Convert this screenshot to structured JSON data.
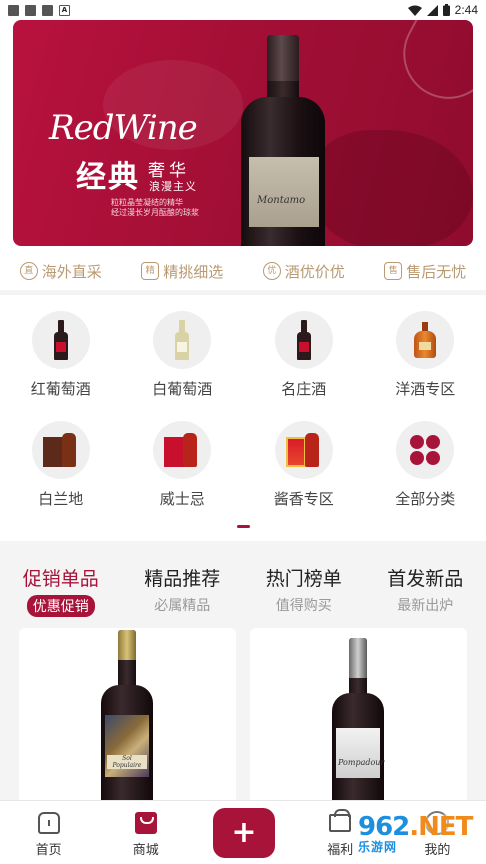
{
  "status_bar": {
    "time": "2:44",
    "icons": [
      "wifi-icon",
      "signal-icon",
      "battery-icon"
    ]
  },
  "banner": {
    "script_text": "RedWine",
    "title_main": "经典",
    "title_sub1": "奢华",
    "title_sub2": "浪漫主义",
    "line1": "粒粒晶莹凝结的精华",
    "line2": "经过漫长岁月酝酿的琼浆",
    "bottle_label": "Montamo"
  },
  "features": [
    {
      "icon": "直",
      "label": "海外直采"
    },
    {
      "icon": "精",
      "label": "精挑细选"
    },
    {
      "icon": "优",
      "label": "酒优价优"
    },
    {
      "icon": "售",
      "label": "售后无忧"
    }
  ],
  "categories": [
    {
      "label": "红葡萄酒",
      "icon": "red-wine-icon"
    },
    {
      "label": "白葡萄酒",
      "icon": "white-wine-icon"
    },
    {
      "label": "名庄酒",
      "icon": "chateau-wine-icon"
    },
    {
      "label": "洋酒专区",
      "icon": "spirits-icon"
    },
    {
      "label": "白兰地",
      "icon": "brandy-icon"
    },
    {
      "label": "威士忌",
      "icon": "whisky-icon"
    },
    {
      "label": "酱香专区",
      "icon": "baijiu-icon"
    },
    {
      "label": "全部分类",
      "icon": "all-categories-icon"
    }
  ],
  "tabs": [
    {
      "title": "促销单品",
      "sub": "优惠促销"
    },
    {
      "title": "精品推荐",
      "sub": "必属精品"
    },
    {
      "title": "热门榜单",
      "sub": "值得购买"
    },
    {
      "title": "首发新品",
      "sub": "最新出炉"
    }
  ],
  "products": [
    {
      "label_text": "Sol Populaire"
    },
    {
      "label_text": "Pompadour"
    }
  ],
  "bottom_nav": [
    {
      "label": "首页",
      "icon": "home-icon"
    },
    {
      "label": "商城",
      "icon": "shop-bag-icon"
    },
    {
      "label": "+",
      "icon": "add-icon"
    },
    {
      "label": "福利",
      "icon": "gift-icon"
    },
    {
      "label": "我的",
      "icon": "profile-icon"
    }
  ],
  "watermark": {
    "main": "962",
    "suffix": ".NET",
    "sub": "乐游网"
  },
  "colors": {
    "accent": "#a8133a",
    "gold": "#b99a72"
  }
}
